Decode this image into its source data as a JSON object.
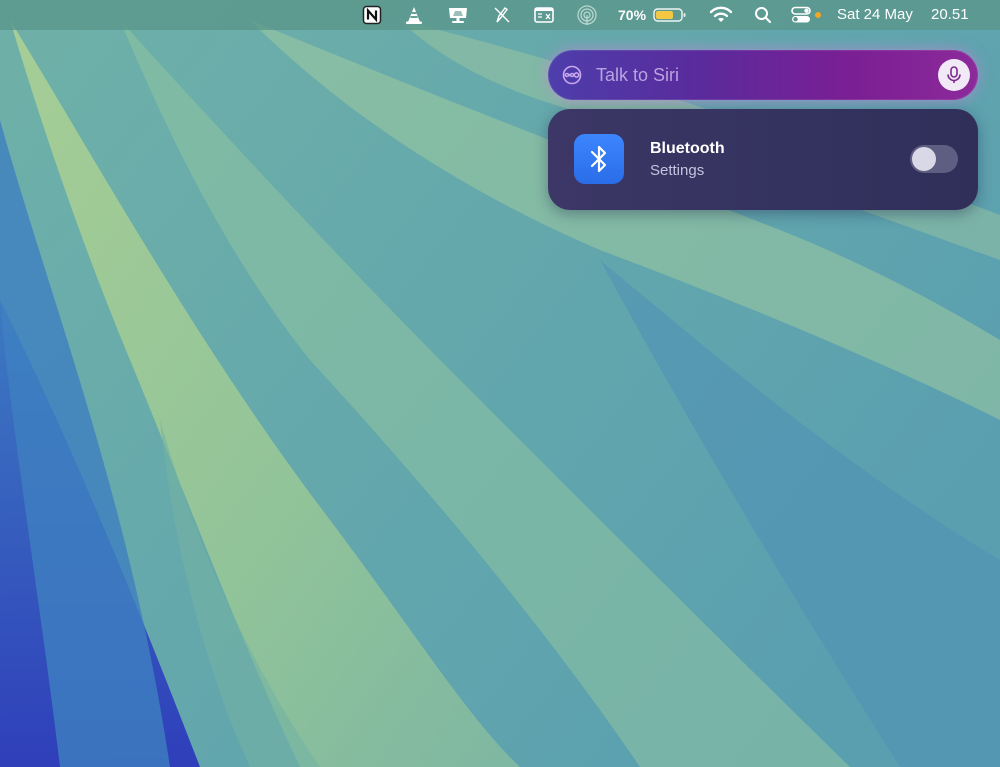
{
  "menubar": {
    "items": [
      {
        "name": "notion-icon"
      },
      {
        "name": "vlc-cone-icon"
      },
      {
        "name": "display-icon"
      },
      {
        "name": "pen-off-icon"
      },
      {
        "name": "window-manager-icon"
      },
      {
        "name": "airdrop-icon"
      },
      {
        "name": "wifi-icon"
      },
      {
        "name": "spotlight-search-icon"
      },
      {
        "name": "control-center-icon"
      }
    ],
    "battery": {
      "percent_label": "70%",
      "level": 0.7
    },
    "date": "Sat 24 May",
    "time": "20.51"
  },
  "siri": {
    "placeholder": "Talk to Siri",
    "value": ""
  },
  "bluetooth_card": {
    "title": "Bluetooth",
    "subtitle": "Settings",
    "enabled": false
  },
  "colors": {
    "menubar_bg": "#5a968a",
    "siri_gradient_start": "#4d3eab",
    "siri_gradient_end": "#8c2a9a",
    "bluetooth_tile": "#3c86ff",
    "card_bg": "#36335f",
    "battery_fill": "#f2c744",
    "status_dot": "#f5a623"
  }
}
